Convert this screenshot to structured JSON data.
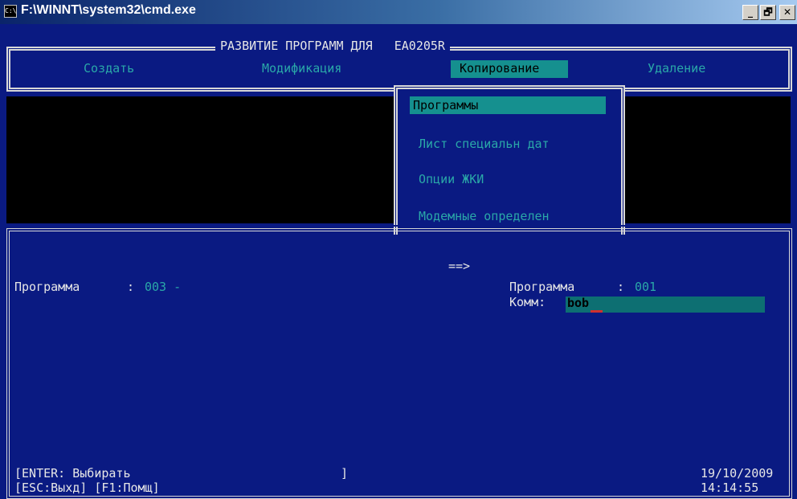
{
  "window": {
    "title": "F:\\WINNT\\system32\\cmd.exe",
    "icon_label": "C:\\",
    "buttons": [
      "_",
      "🗗",
      "✕"
    ]
  },
  "header": {
    "title": "РАЗВИТИЕ ПРОГРАММ ДЛЯ",
    "device": "EA0205R"
  },
  "menu": [
    "Создать",
    "Модификация",
    "Копирование",
    "Удаление"
  ],
  "submenu": [
    "Программы",
    "Лист специальн дат",
    "Опции ЖКИ",
    "Модемные определен"
  ],
  "copy": {
    "arrow": "==>",
    "src_label": "Программа",
    "src_sep": ":",
    "src_value": "003 -",
    "dst_label": "Программа",
    "dst_sep": ":",
    "dst_value": "001",
    "comment_label": "Комм:",
    "comment_value": "bob"
  },
  "footer": {
    "line1": "[ENTER: Выбирать",
    "bracket": "]",
    "line2": "[ESC:Выхд] [F1:Помщ]",
    "date": "19/10/2009",
    "time": "14:14:55"
  },
  "colors": {
    "background": "#0a1a82",
    "highlight": "#15908f",
    "border": "#d8d8d8"
  }
}
